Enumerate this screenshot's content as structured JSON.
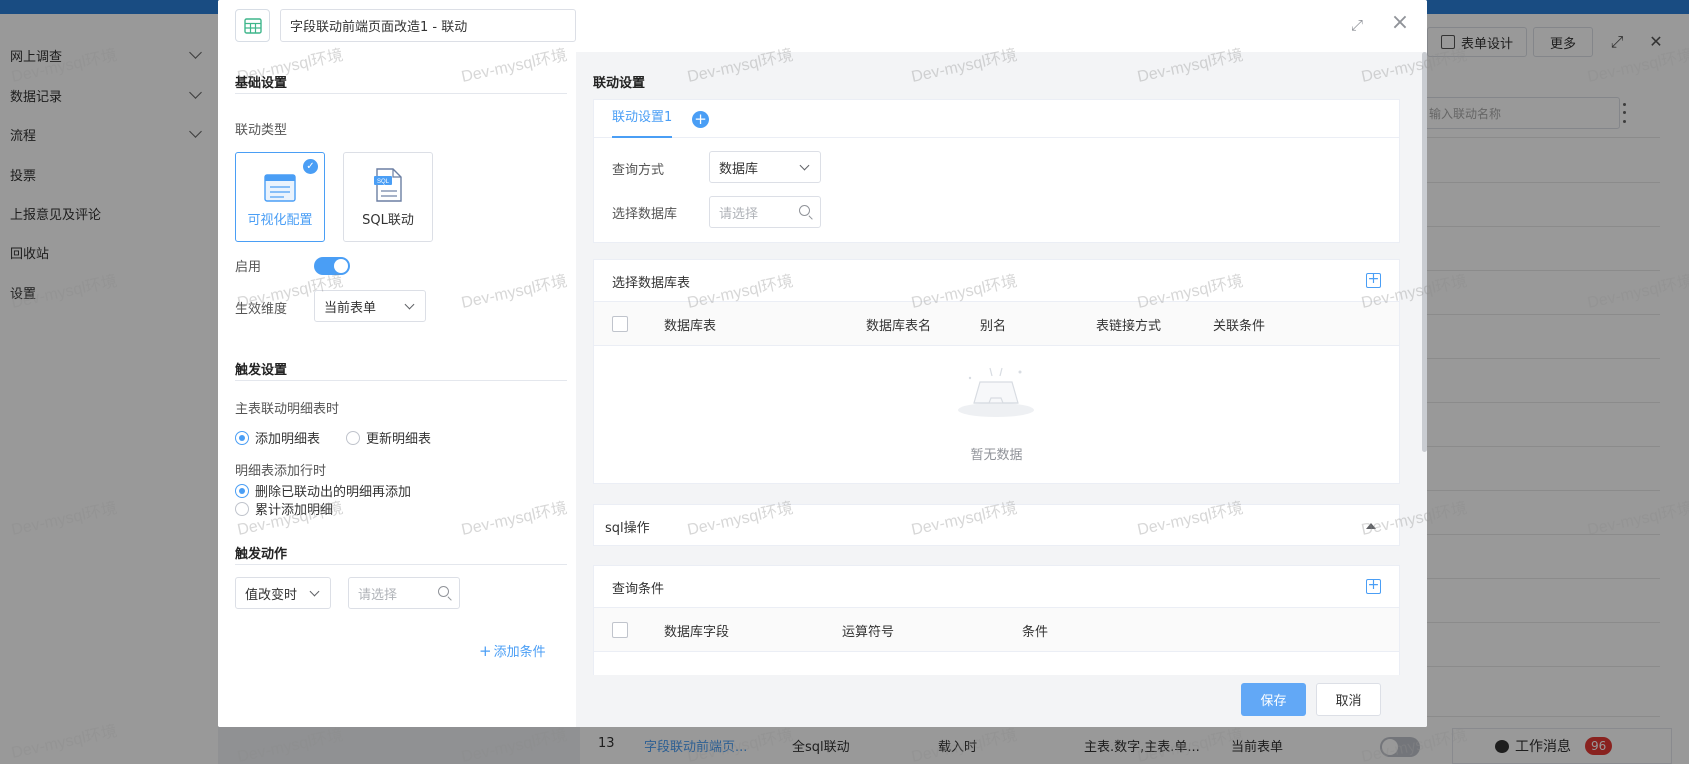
{
  "app": {
    "sidebar": [
      {
        "label": "网上调查",
        "has_children": true
      },
      {
        "label": "数据记录",
        "has_children": true
      },
      {
        "label": "流程",
        "has_children": true
      },
      {
        "label": "投票",
        "has_children": false
      },
      {
        "label": "上报意见及评论",
        "has_children": false
      },
      {
        "label": "回收站",
        "has_children": false
      },
      {
        "label": "设置",
        "has_children": false
      }
    ],
    "toolbar": {
      "form_design": "表单设计",
      "more": "更多"
    },
    "search_placeholder": "输入联动名称",
    "row13": {
      "index": "13",
      "name": "字段联动前端页...",
      "type": "全sql联动",
      "trigger": "载入时",
      "fields": "主表.数字,主表.单...",
      "scope": "当前表单"
    },
    "messages": {
      "label": "工作消息",
      "count": "96"
    }
  },
  "watermark": "Dev-mysql环境",
  "dialog": {
    "title": "字段联动前端页面改造1 - 联动",
    "left": {
      "basic_section": "基础设置",
      "type_label": "联动类型",
      "type_options": [
        {
          "label": "可视化配置",
          "active": true
        },
        {
          "label": "SQL联动",
          "active": false
        }
      ],
      "enable_label": "启用",
      "enabled": true,
      "scope_label": "生效维度",
      "scope_value": "当前表单",
      "trigger_section": "触发设置",
      "master_detail_label": "主表联动明细表时",
      "master_detail_options": [
        {
          "label": "添加明细表",
          "checked": true
        },
        {
          "label": "更新明细表",
          "checked": false
        }
      ],
      "detail_add_label": "明细表添加行时",
      "detail_add_options": [
        {
          "label": "删除已联动出的明细再添加",
          "checked": true
        },
        {
          "label": "累计添加明细",
          "checked": false
        }
      ],
      "action_section": "触发动作",
      "action_select": "值改变时",
      "action_placeholder": "请选择",
      "add_condition": "添加条件"
    },
    "right": {
      "section_title": "联动设置",
      "tab_label": "联动设置1",
      "query_mode_label": "查询方式",
      "query_mode_value": "数据库",
      "db_label": "选择数据库",
      "db_placeholder": "请选择",
      "table_card_title": "选择数据库表",
      "table_columns": [
        "数据库表",
        "数据库表名",
        "别名",
        "表链接方式",
        "关联条件"
      ],
      "empty_text": "暂无数据",
      "sql_title": "sql操作",
      "condition_title": "查询条件",
      "condition_columns": [
        "数据库字段",
        "运算符号",
        "条件"
      ]
    },
    "save": "保存",
    "cancel": "取消"
  }
}
